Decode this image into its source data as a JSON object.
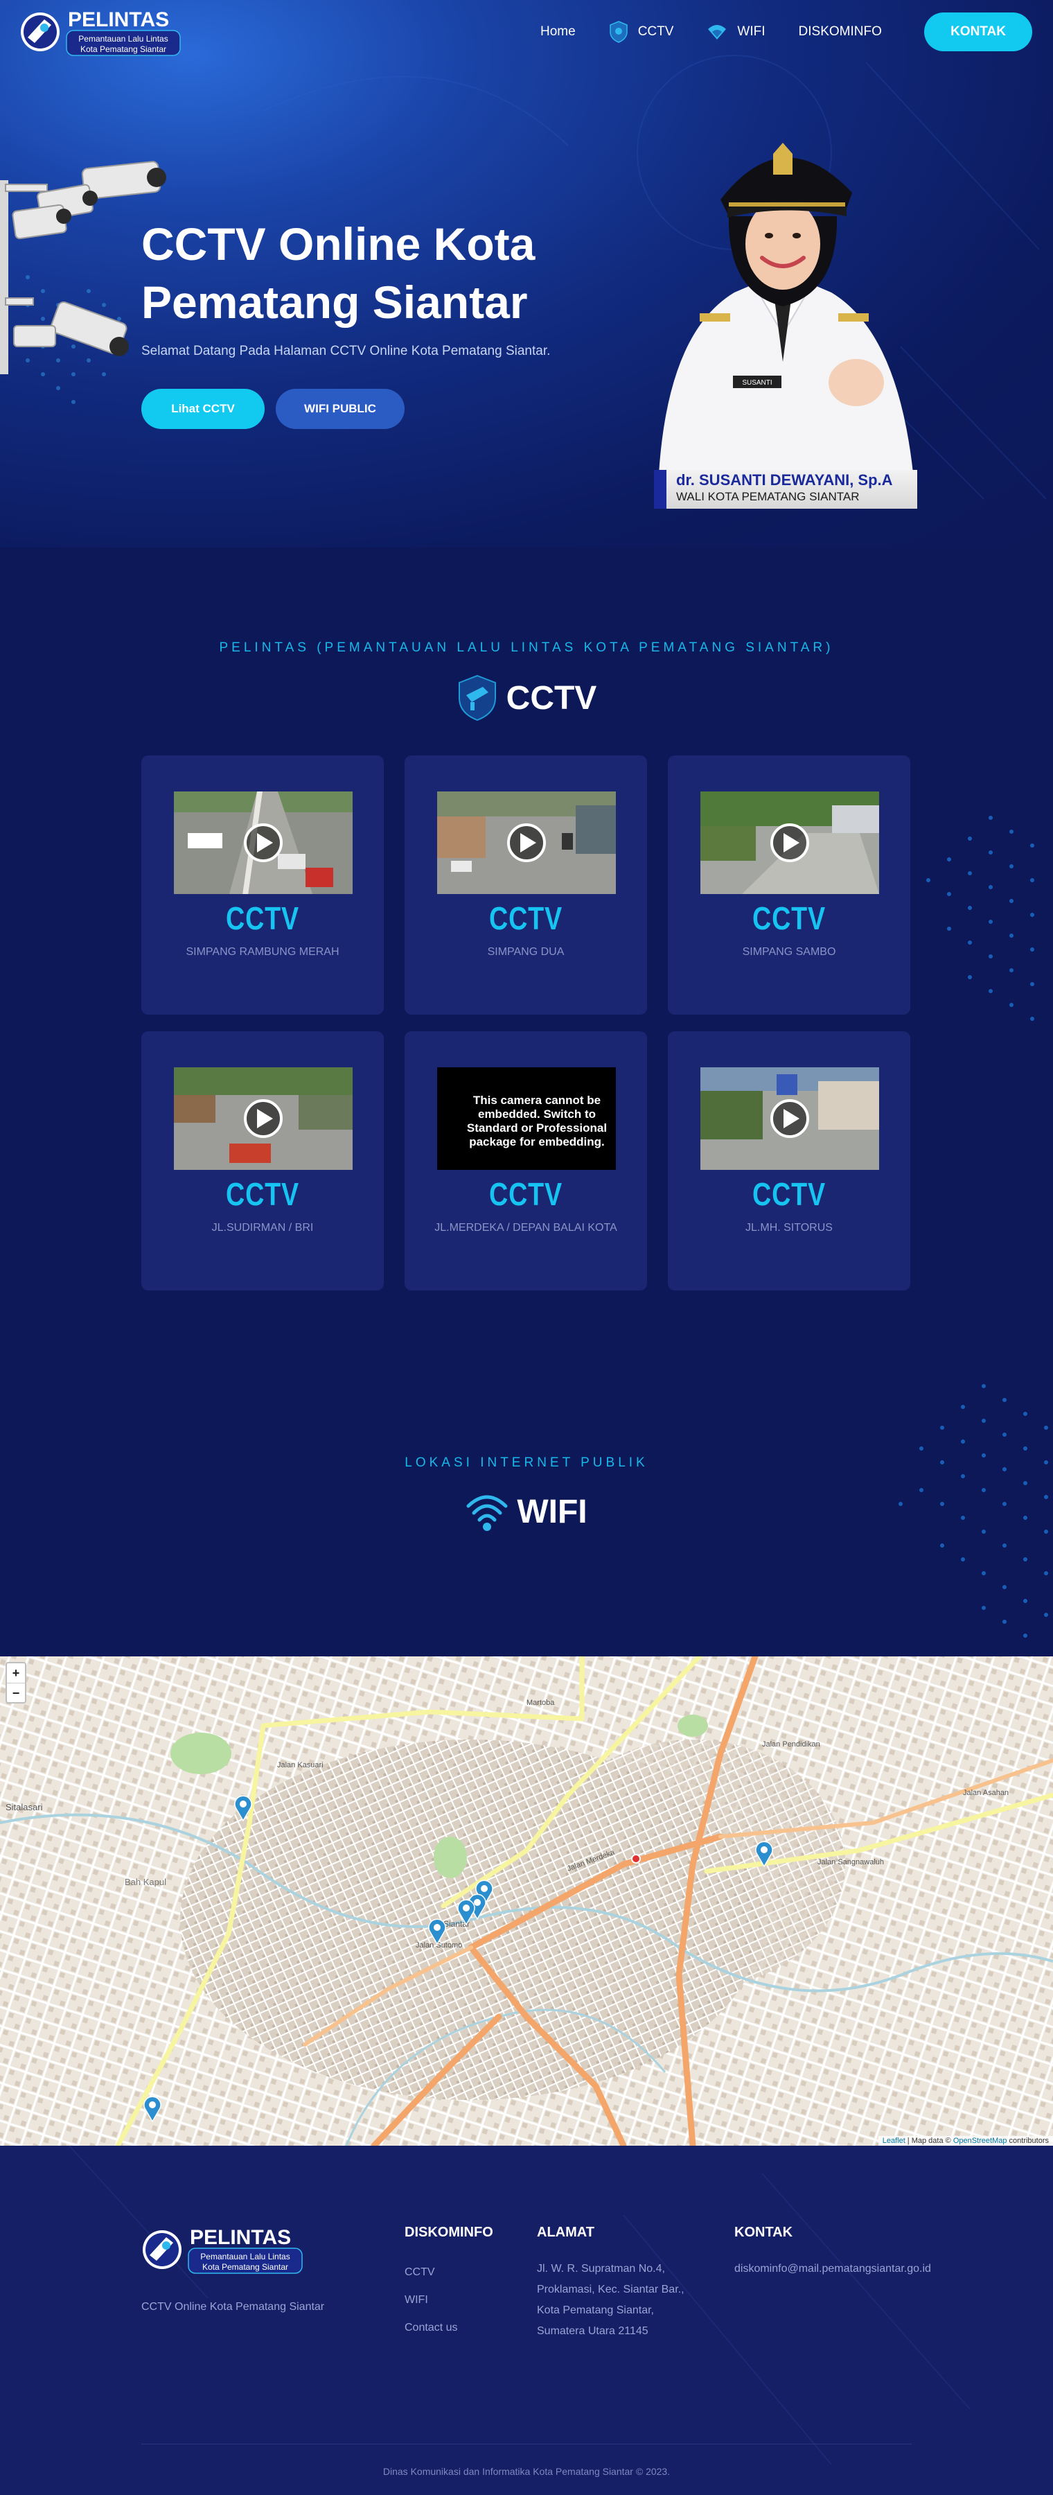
{
  "nav": {
    "logo_title": "PELINTAS",
    "logo_sub1": "Pemantauan Lalu Lintas",
    "logo_sub2": "Kota Pematang Siantar",
    "links": [
      "Home",
      "CCTV",
      "WIFI",
      "DISKOMINFO"
    ],
    "kontak": "KONTAK"
  },
  "hero": {
    "title_line1": "CCTV Online Kota",
    "title_line2": "Pematang Siantar",
    "subtitle": "Selamat Datang Pada Halaman CCTV Online Kota Pematang Siantar.",
    "btn_cctv": "Lihat CCTV",
    "btn_wifi": "WIFI PUBLIC",
    "mayor_name": "dr. SUSANTI DEWAYANI, Sp.A",
    "mayor_role": "WALI KOTA PEMATANG SIANTAR",
    "badge_text": "SUSANTI"
  },
  "cctv_section": {
    "subtitle": "PELINTAS (PEMANTAUAN LALU LINTAS KOTA PEMATANG SIANTAR)",
    "title": "CCTV",
    "cards": [
      {
        "label": "CCTV",
        "location": "SIMPANG RAMBUNG MERAH"
      },
      {
        "label": "CCTV",
        "location": "SIMPANG DUA"
      },
      {
        "label": "CCTV",
        "location": "SIMPANG SAMBO"
      },
      {
        "label": "CCTV",
        "location": "JL.SUDIRMAN / BRI"
      },
      {
        "label": "CCTV",
        "location": "JL.MERDEKA / DEPAN BALAI KOTA",
        "message": "This camera cannot be embedded. Switch to Standard or Professional package for embedding."
      },
      {
        "label": "CCTV",
        "location": "JL.MH. SITORUS"
      }
    ]
  },
  "wifi_section": {
    "subtitle": "LOKASI INTERNET PUBLIK",
    "title": "WIFI"
  },
  "map": {
    "zoom_in": "+",
    "zoom_out": "−",
    "attribution_leaflet": "Leaflet",
    "attribution_mid": " | Map data © ",
    "attribution_osm": "OpenStreetMap",
    "attribution_end": " contributors",
    "labels": [
      "Sitalasari",
      "Bah Kapul",
      "Jalan Kasuari",
      "Jalan Asahan",
      "Jalan Merdeka",
      "Jalan Sutomo",
      "Siantar",
      "Martoba",
      "Jalan Sangnawaluh",
      "Jalan Pendidikan"
    ]
  },
  "footer": {
    "logo_title": "PELINTAS",
    "logo_sub1": "Pemantauan Lalu Lintas",
    "logo_sub2": "Kota Pematang Siantar",
    "tagline": "CCTV Online Kota Pematang Siantar",
    "col1_head": "DISKOMINFO",
    "col1_items": [
      "CCTV",
      "WIFI",
      "Contact us"
    ],
    "col2_head": "ALAMAT",
    "col2_lines": [
      "Jl. W. R. Supratman No.4,",
      "Proklamasi, Kec. Siantar Bar.,",
      "Kota Pematang Siantar,",
      "Sumatera Utara 21145"
    ],
    "col3_head": "KONTAK",
    "col3_email": "diskominfo@mail.pematangsiantar.go.id",
    "copyright": "Dinas Komunikasi dan Informatika Kota Pematang Siantar © 2023."
  },
  "colors": {
    "background": "#0c1858",
    "accent": "#12c9ef",
    "card": "#1a2672",
    "secondary_button": "#2b5cc4"
  }
}
